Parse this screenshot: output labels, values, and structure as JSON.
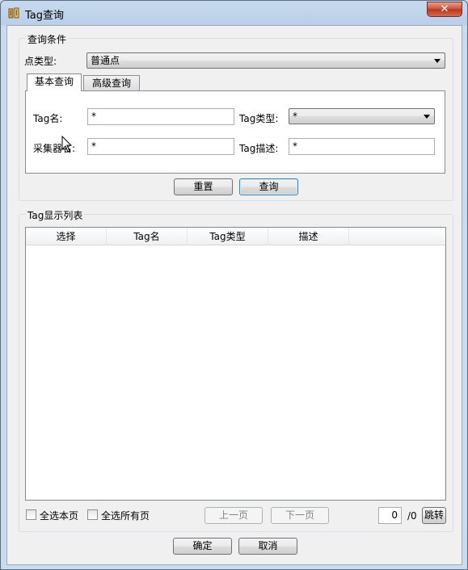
{
  "window": {
    "title": "Tag查询",
    "close_glyph": "✕"
  },
  "query_group": {
    "legend": "查询条件",
    "point_type_label": "点类型:",
    "point_type_value": "普通点",
    "tabs": [
      "基本查询",
      "高级查询"
    ],
    "basic": {
      "tag_name_label": "Tag名:",
      "tag_name_value": "*",
      "tag_type_label": "Tag类型:",
      "tag_type_value": "*",
      "collector_label": "采集器名:",
      "collector_value": "*",
      "tag_desc_label": "Tag描述:",
      "tag_desc_value": "*"
    },
    "reset_label": "重置",
    "query_label": "查询"
  },
  "list_group": {
    "legend": "Tag显示列表",
    "columns": [
      "选择",
      "Tag名",
      "Tag类型",
      "描述"
    ],
    "select_page_label": "全选本页",
    "select_all_label": "全选所有页",
    "prev_label": "上一页",
    "next_label": "下一页",
    "page_value": "0",
    "page_total": "/0",
    "jump_label": "跳转"
  },
  "footer": {
    "ok_label": "确定",
    "cancel_label": "取消"
  }
}
